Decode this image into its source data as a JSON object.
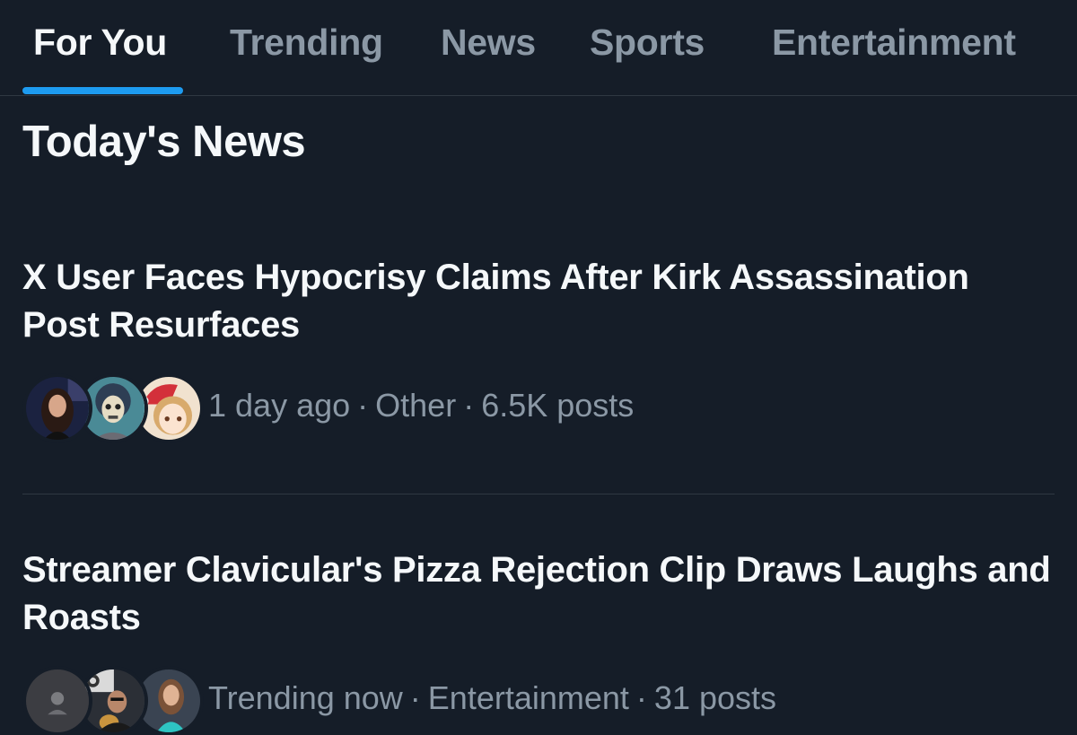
{
  "tabs": [
    {
      "label": "For You",
      "active": true
    },
    {
      "label": "Trending",
      "active": false
    },
    {
      "label": "News",
      "active": false
    },
    {
      "label": "Sports",
      "active": false
    },
    {
      "label": "Entertainment",
      "active": false
    }
  ],
  "section_title": "Today's News",
  "news": [
    {
      "headline": "X User Faces Hypocrisy Claims After Kirk Assassination Post Resurfaces",
      "time": "1 day ago",
      "category": "Other",
      "posts": "6.5K posts",
      "avatars": [
        "avatar-woman-dark-hair",
        "avatar-skull-character",
        "avatar-anime-santa-hat"
      ]
    },
    {
      "headline": "Streamer Clavicular's Pizza Rejection Clip Draws Laughs and Roasts",
      "time": "Trending now",
      "category": "Entertainment",
      "posts": "31 posts",
      "avatars": [
        "avatar-person-silhouette",
        "avatar-man-with-dog",
        "avatar-woman-teal-top"
      ]
    }
  ],
  "colors": {
    "background": "#151d28",
    "primary_text": "#f5f8fa",
    "secondary_text": "#8b98a5",
    "accent": "#1d9bf0",
    "divider": "#2f3842"
  }
}
